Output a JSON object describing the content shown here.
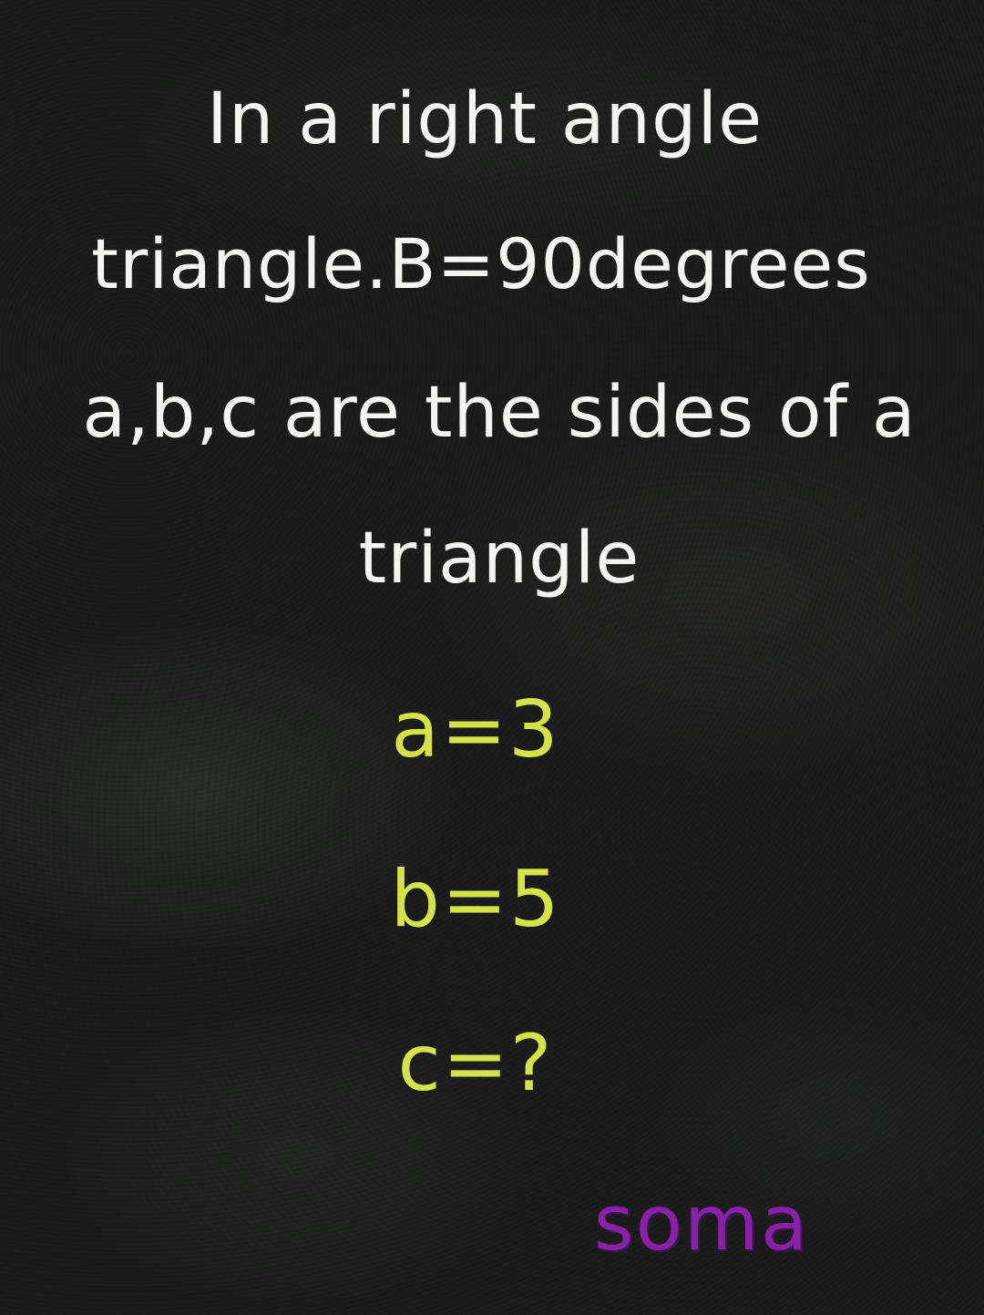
{
  "question": {
    "line1": "In a right angle",
    "line2": "triangle.B=90degrees",
    "line3": "a,b,c are the sides of a",
    "line4": "triangle"
  },
  "values": {
    "a": "a=3",
    "b": "b=5",
    "c": "c=?"
  },
  "brand": "soma",
  "colors": {
    "background": "#1b1c1b",
    "question_text": "#f4f4f2",
    "values_text": "#d4e34a",
    "brand_text": "#8a1fa8"
  }
}
